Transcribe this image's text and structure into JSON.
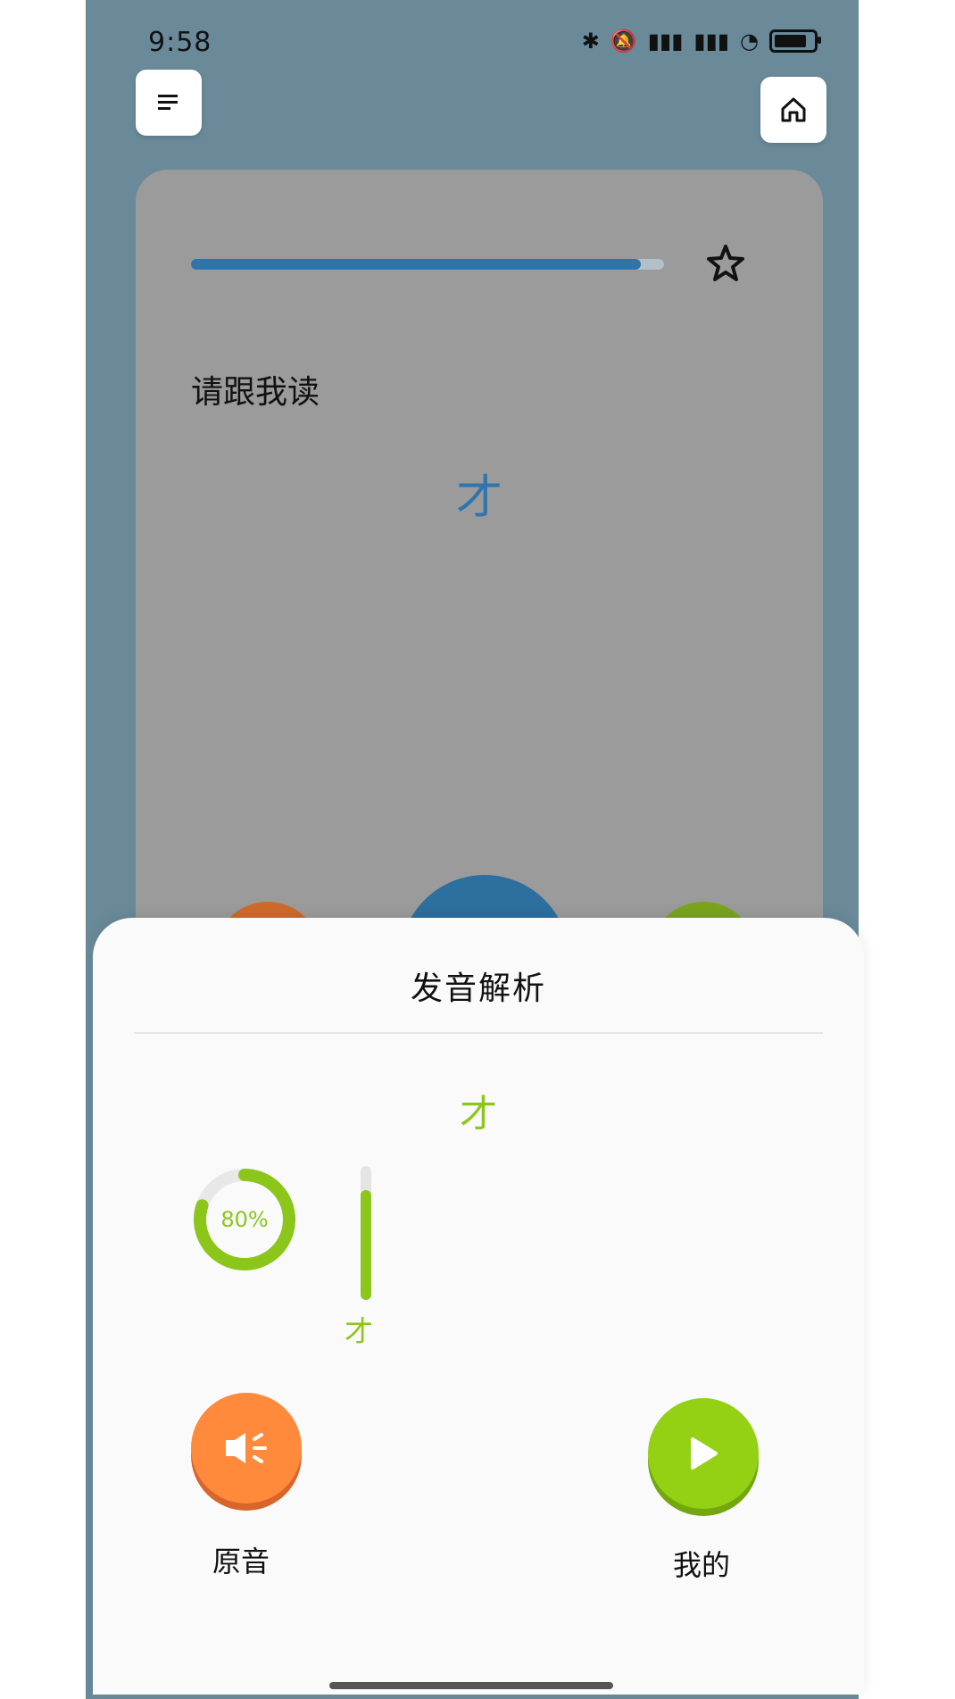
{
  "status_bar": {
    "time": "9:58",
    "icons": [
      "bluetooth-icon",
      "mute-icon",
      "hd-signal-icon",
      "hd-signal-icon",
      "wifi-icon",
      "battery-icon"
    ]
  },
  "header": {
    "menu_icon": "menu-icon",
    "home_icon": "home-icon"
  },
  "card": {
    "progress": 0.95,
    "favorite_icon": "star-icon",
    "prompt": "请跟我读",
    "target_char": "才"
  },
  "sheet": {
    "title": "发音解析",
    "char": "才",
    "score_label": "80%",
    "score": 0.8,
    "bar_level": 0.82,
    "bar_char": "才",
    "original_label": "原音",
    "mine_label": "我的"
  },
  "colors": {
    "accent_blue": "#2f74ad",
    "accent_green": "#8cc61b",
    "accent_orange": "#ff8a3c"
  }
}
